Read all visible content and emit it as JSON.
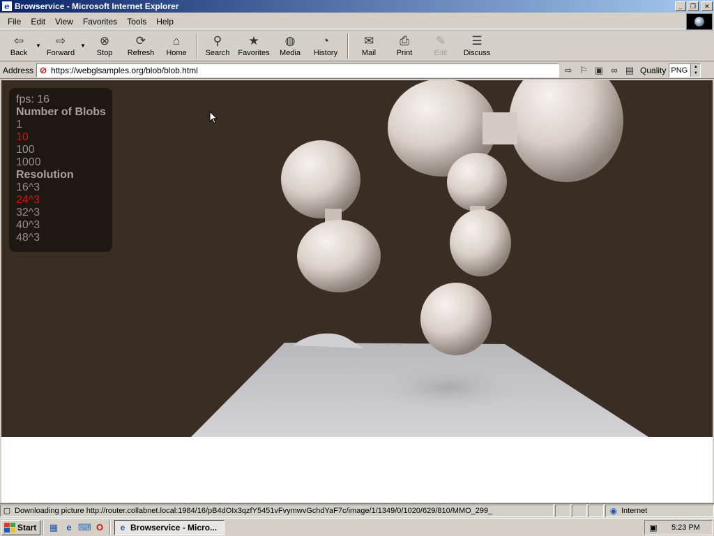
{
  "window": {
    "title": "Browservice - Microsoft Internet Explorer",
    "icon": "ie-icon"
  },
  "menu": [
    "File",
    "Edit",
    "View",
    "Favorites",
    "Tools",
    "Help"
  ],
  "toolbar": {
    "back": "Back",
    "forward": "Forward",
    "stop": "Stop",
    "refresh": "Refresh",
    "home": "Home",
    "search": "Search",
    "favorites": "Favorites",
    "media": "Media",
    "history": "History",
    "mail": "Mail",
    "print": "Print",
    "edit": "Edit",
    "discuss": "Discuss"
  },
  "address": {
    "label": "Address",
    "url": "https://webglsamples.org/blob/blob.html",
    "quality_label": "Quality",
    "quality_value": "PNG"
  },
  "overlay": {
    "fps": "fps: 16",
    "blobs_heading": "Number of Blobs",
    "blobs_options": [
      "1",
      "10",
      "100",
      "1000"
    ],
    "blobs_selected": "10",
    "resolution_heading": "Resolution",
    "resolution_options": [
      "16^3",
      "24^3",
      "32^3",
      "40^3",
      "48^3"
    ],
    "resolution_selected": "24^3"
  },
  "colors": {
    "scene_background": "#3a2d23",
    "blob_color": "#d8d0c8",
    "floor_color": "#c8c8cc",
    "selected_option": "#e01010"
  },
  "status": {
    "text": "Downloading picture http://router.collabnet.local:1984/16/pB4dOIx3qzfY5451vFvymwvGchdYaF7c/image/1/1349/0/1020/629/810/MMO_299_",
    "zone": "Internet"
  },
  "taskbar": {
    "start": "Start",
    "task": "Browservice - Micro...",
    "clock": "5:23 PM"
  }
}
